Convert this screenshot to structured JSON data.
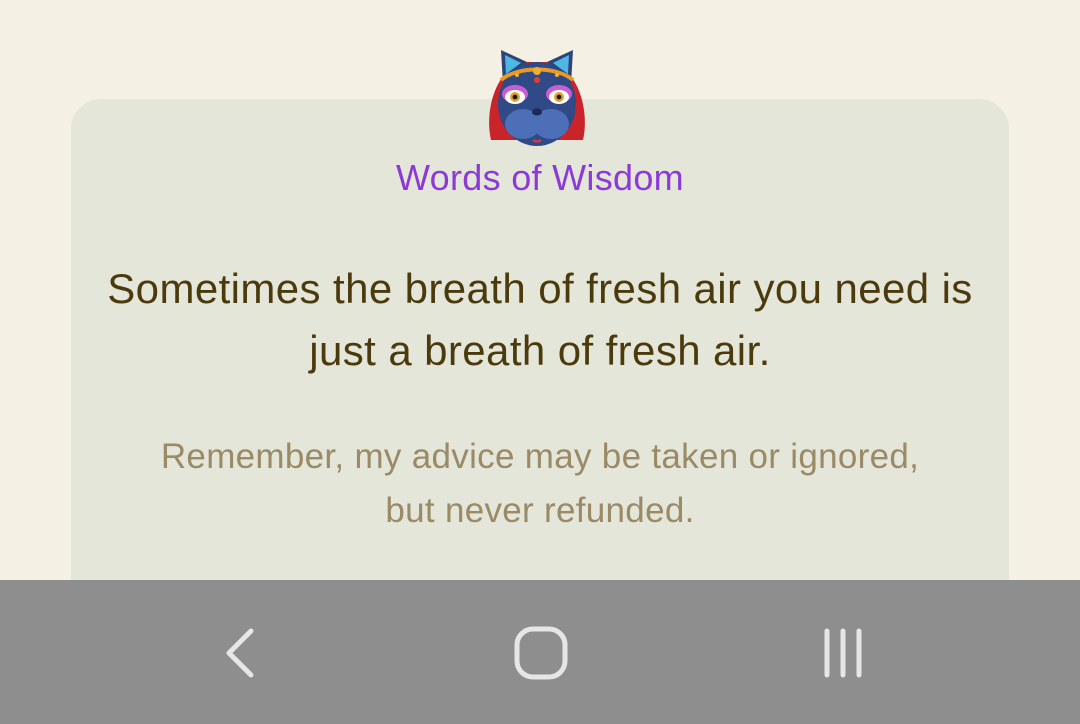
{
  "card": {
    "title": "Words of Wisdom",
    "quote": "Sometimes the breath of fresh air you need is just a breath of fresh air.",
    "disclaimer": "Remember, my advice may be taken or ignored, but never refunded."
  },
  "avatar": {
    "icon": "cat-fortune-teller-icon"
  },
  "navigation": {
    "back_icon": "back-chevron-icon",
    "home_icon": "home-icon",
    "recents_icon": "recents-icon"
  },
  "colors": {
    "background": "#f4f0e3",
    "card": "#e5e6da",
    "title": "#8b3ad8",
    "quote": "#4b3a0c",
    "disclaimer": "#9a8a66",
    "nav_bar": "#8e8e8e"
  }
}
